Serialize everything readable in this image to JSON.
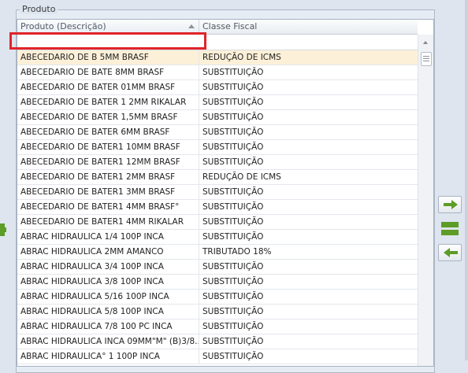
{
  "group": {
    "title": "Produto"
  },
  "grid": {
    "columns": [
      "Produto (Descrição)",
      "Classe Fiscal"
    ],
    "filter": {
      "value": "",
      "placeholder": ""
    },
    "rows": [
      {
        "produto": "ABECEDARIO DE B 5MM BRASF",
        "classe": "REDUÇÃO DE ICMS"
      },
      {
        "produto": "ABECEDARIO DE BATE 8MM BRASF",
        "classe": "SUBSTITUIÇÃO"
      },
      {
        "produto": "ABECEDARIO DE BATER 01MM BRASF",
        "classe": "SUBSTITUIÇÃO"
      },
      {
        "produto": "ABECEDARIO DE BATER 1 2MM RIKALAR",
        "classe": "SUBSTITUIÇÃO"
      },
      {
        "produto": "ABECEDARIO DE BATER 1,5MM BRASF",
        "classe": "SUBSTITUIÇÃO"
      },
      {
        "produto": "ABECEDARIO DE BATER 6MM BRASF",
        "classe": "SUBSTITUIÇÃO"
      },
      {
        "produto": "ABECEDARIO DE BATER1 10MM BRASF",
        "classe": "SUBSTITUIÇÃO"
      },
      {
        "produto": "ABECEDARIO DE BATER1 12MM BRASF",
        "classe": "SUBSTITUIÇÃO"
      },
      {
        "produto": "ABECEDARIO DE BATER1 2MM BRASF",
        "classe": "REDUÇÃO DE ICMS"
      },
      {
        "produto": "ABECEDARIO DE BATER1 3MM BRASF",
        "classe": "SUBSTITUIÇÃO"
      },
      {
        "produto": "ABECEDARIO DE BATER1 4MM BRASF°",
        "classe": "SUBSTITUIÇÃO"
      },
      {
        "produto": "ABECEDARIO DE BATER1 4MM RIKALAR",
        "classe": "SUBSTITUIÇÃO"
      },
      {
        "produto": "ABRAC HIDRAULICA 1/4 100P INCA",
        "classe": "SUBSTITUIÇÃO"
      },
      {
        "produto": "ABRAC HIDRAULICA 2MM AMANCO",
        "classe": "TRIBUTADO 18%"
      },
      {
        "produto": "ABRAC HIDRAULICA 3/4 100P INCA",
        "classe": "SUBSTITUIÇÃO"
      },
      {
        "produto": "ABRAC HIDRAULICA 3/8 100P INCA",
        "classe": "SUBSTITUIÇÃO"
      },
      {
        "produto": "ABRAC HIDRAULICA 5/16 100P INCA",
        "classe": "SUBSTITUIÇÃO"
      },
      {
        "produto": "ABRAC HIDRAULICA 5/8 100P INCA",
        "classe": "SUBSTITUIÇÃO"
      },
      {
        "produto": "ABRAC HIDRAULICA 7/8 100 PC INCA",
        "classe": "SUBSTITUIÇÃO"
      },
      {
        "produto": "ABRAC HIDRAULICA INCA 09MM\"M\" (B)3/8...",
        "classe": "SUBSTITUIÇÃO"
      },
      {
        "produto": "ABRAC HIDRAULICA° 1 100P INCA",
        "classe": "SUBSTITUIÇÃO"
      }
    ],
    "selected_row": 0
  },
  "icons": {
    "add": "plus-icon",
    "move_right": "arrow-right-icon",
    "move_all": "equals-icon",
    "move_left": "arrow-left-icon"
  },
  "colors": {
    "highlight": "#e0242b",
    "selected_row": "#fdf0d8",
    "icon_green": "#5c9c27"
  }
}
